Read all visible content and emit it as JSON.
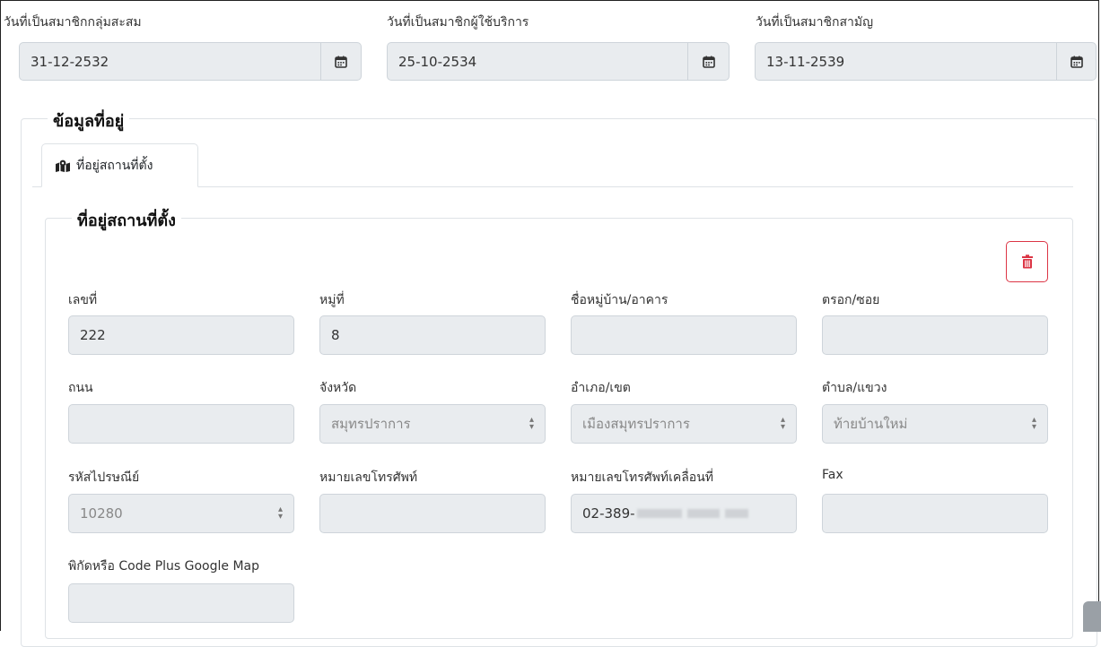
{
  "dates": {
    "group_member": {
      "label": "วันที่เป็นสมาชิกกลุ่มสะสม",
      "value": "31-12-2532"
    },
    "service_user": {
      "label": "วันที่เป็นสมาชิกผู้ใช้บริการ",
      "value": "25-10-2534"
    },
    "ordinary": {
      "label": "วันที่เป็นสมาชิกสามัญ",
      "value": "13-11-2539"
    }
  },
  "address_section": {
    "title": "ข้อมูลที่อยู่",
    "tab_label": "ที่อยู่สถานที่ตั้ง",
    "tab_icon": "map-location-icon"
  },
  "location": {
    "title": "ที่อยู่สถานที่ตั้ง",
    "delete_icon": "trash-icon",
    "accent_color": "#dc3545",
    "fields": {
      "house_no": {
        "label": "เลขที่",
        "value": "222"
      },
      "moo": {
        "label": "หมู่ที่",
        "value": "8"
      },
      "village": {
        "label": "ชื่อหมู่บ้าน/อาคาร",
        "value": ""
      },
      "soi": {
        "label": "ตรอก/ซอย",
        "value": ""
      },
      "road": {
        "label": "ถนน",
        "value": ""
      },
      "province": {
        "label": "จังหวัด",
        "value": "สมุทรปราการ"
      },
      "district": {
        "label": "อำเภอ/เขต",
        "value": "เมืองสมุทรปราการ"
      },
      "subdistrict": {
        "label": "ตำบล/แขวง",
        "value": "ท้ายบ้านใหม่"
      },
      "postcode": {
        "label": "รหัสไปรษณีย์",
        "value": "10280"
      },
      "phone": {
        "label": "หมายเลขโทรศัพท์",
        "value": ""
      },
      "mobile": {
        "label": "หมายเลขโทรศัพท์เคลื่อนที่",
        "value": "02-389-"
      },
      "fax": {
        "label": "Fax",
        "value": ""
      },
      "plus_code": {
        "label": "พิกัดหรือ Code Plus Google Map",
        "value": ""
      }
    }
  }
}
